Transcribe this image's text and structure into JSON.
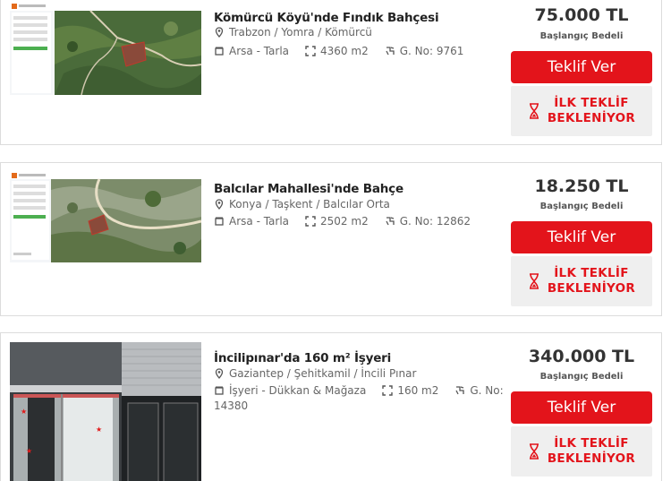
{
  "listings": [
    {
      "title": "Kömürcü Köyü'nde Fındık Bahçesi",
      "location": "Trabzon / Yomra / Kömürcü",
      "type": "Arsa - Tarla",
      "area": "4360 m2",
      "gno": "G. No: 9761",
      "price": "75.000 TL",
      "price_label": "Başlangıç Bedeli",
      "bid_label": "Teklif Ver",
      "status_line1": "İLK TEKLİF",
      "status_line2": "BEKLENİYOR"
    },
    {
      "title": "Balcılar Mahallesi'nde Bahçe",
      "location": "Konya / Taşkent / Balcılar Orta",
      "type": "Arsa - Tarla",
      "area": "2502 m2",
      "gno": "G. No: 12862",
      "price": "18.250 TL",
      "price_label": "Başlangıç Bedeli",
      "bid_label": "Teklif Ver",
      "status_line1": "İLK TEKLİF",
      "status_line2": "BEKLENİYOR"
    },
    {
      "title": "İncilipınar'da 160 m² İşyeri",
      "location": "Gaziantep / Şehitkamil / İncili Pınar",
      "type": "İşyeri - Dükkan & Mağaza",
      "area": "160 m2",
      "gno": "G. No:",
      "gno_value": "14380",
      "price": "340.000 TL",
      "price_label": "Başlangıç Bedeli",
      "bid_label": "Teklif Ver",
      "status_line1": "İLK TEKLİF",
      "status_line2": "BEKLENİYOR"
    }
  ],
  "colors": {
    "accent": "#e3141b",
    "status_bg": "#efefef"
  },
  "icons": [
    "map-pin-icon",
    "building-icon",
    "area-icon",
    "parcel-icon",
    "hourglass-icon"
  ]
}
